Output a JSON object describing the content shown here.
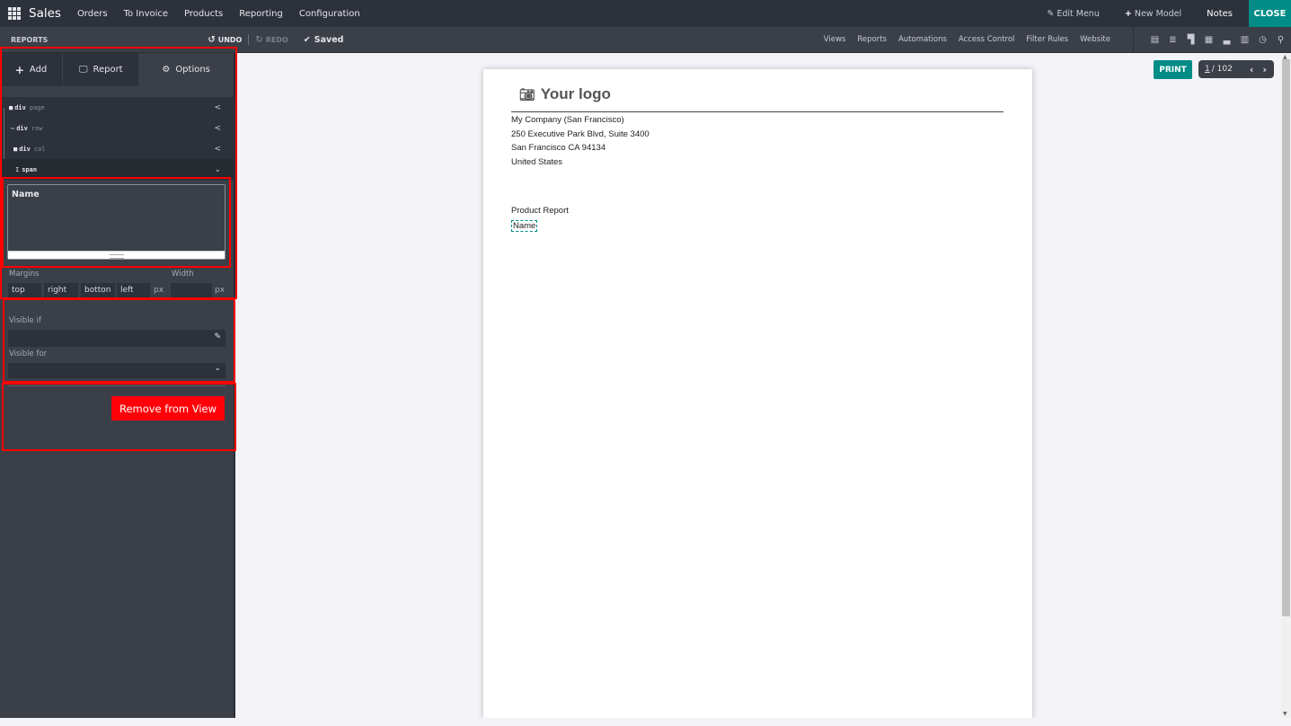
{
  "topbar": {
    "app_name": "Sales",
    "menus": [
      "Orders",
      "To Invoice",
      "Products",
      "Reporting",
      "Configuration"
    ],
    "edit_menu": "Edit Menu",
    "new_model": "New Model",
    "notes": "Notes",
    "close": "CLOSE"
  },
  "subbar": {
    "breadcrumb": "REPORTS",
    "undo": "UNDO",
    "redo": "REDO",
    "saved": "Saved",
    "links": [
      "Views",
      "Reports",
      "Automations",
      "Access Control",
      "Filter Rules",
      "Website"
    ],
    "view_icons": [
      "form-view-icon",
      "list-view-icon",
      "kanban-view-icon",
      "calendar-view-icon",
      "graph-view-icon",
      "pivot-view-icon",
      "activity-view-icon",
      "search-view-icon"
    ]
  },
  "sidebar": {
    "tabs": [
      {
        "label": "Add",
        "icon": "plus-icon"
      },
      {
        "label": "Report",
        "icon": "monitor-icon"
      },
      {
        "label": "Options",
        "icon": "gear-icon",
        "active": true
      }
    ],
    "tree": [
      {
        "tag": "div",
        "cls": "page",
        "icon": "folder-icon",
        "chevron": "<"
      },
      {
        "tag": "div",
        "cls": "row",
        "icon": "ellipsis-icon",
        "chevron": "<"
      },
      {
        "tag": "div",
        "cls": "col",
        "icon": "folder-icon",
        "chevron": "<"
      },
      {
        "tag": "span",
        "cls": "",
        "icon": "text-cursor-icon",
        "chevron": "⌄"
      }
    ],
    "editor_text": "Name",
    "margins_label": "Margins",
    "width_label": "Width",
    "margin_fields": {
      "top": "top",
      "right": "right",
      "bottom": "botton",
      "left": "left"
    },
    "px_unit": "px",
    "visible_if_label": "Visible if",
    "visible_for_label": "Visible for",
    "remove_button": "Remove from View",
    "highlight_color": "#ff0000"
  },
  "report": {
    "logo_text": "Your logo",
    "company_lines": [
      "My Company (San Francisco)",
      "250 Executive Park Blvd, Suite 3400",
      "San Francisco CA 94134",
      "United States"
    ],
    "title": "Product Report",
    "field": "Name"
  },
  "toolbar": {
    "print": "PRINT",
    "pager_current": "1",
    "pager_total": "/ 102"
  },
  "colors": {
    "accent": "#018c85",
    "danger": "#ff0008",
    "topbar_bg": "#2c313b",
    "panel_bg": "#3b3f48"
  }
}
